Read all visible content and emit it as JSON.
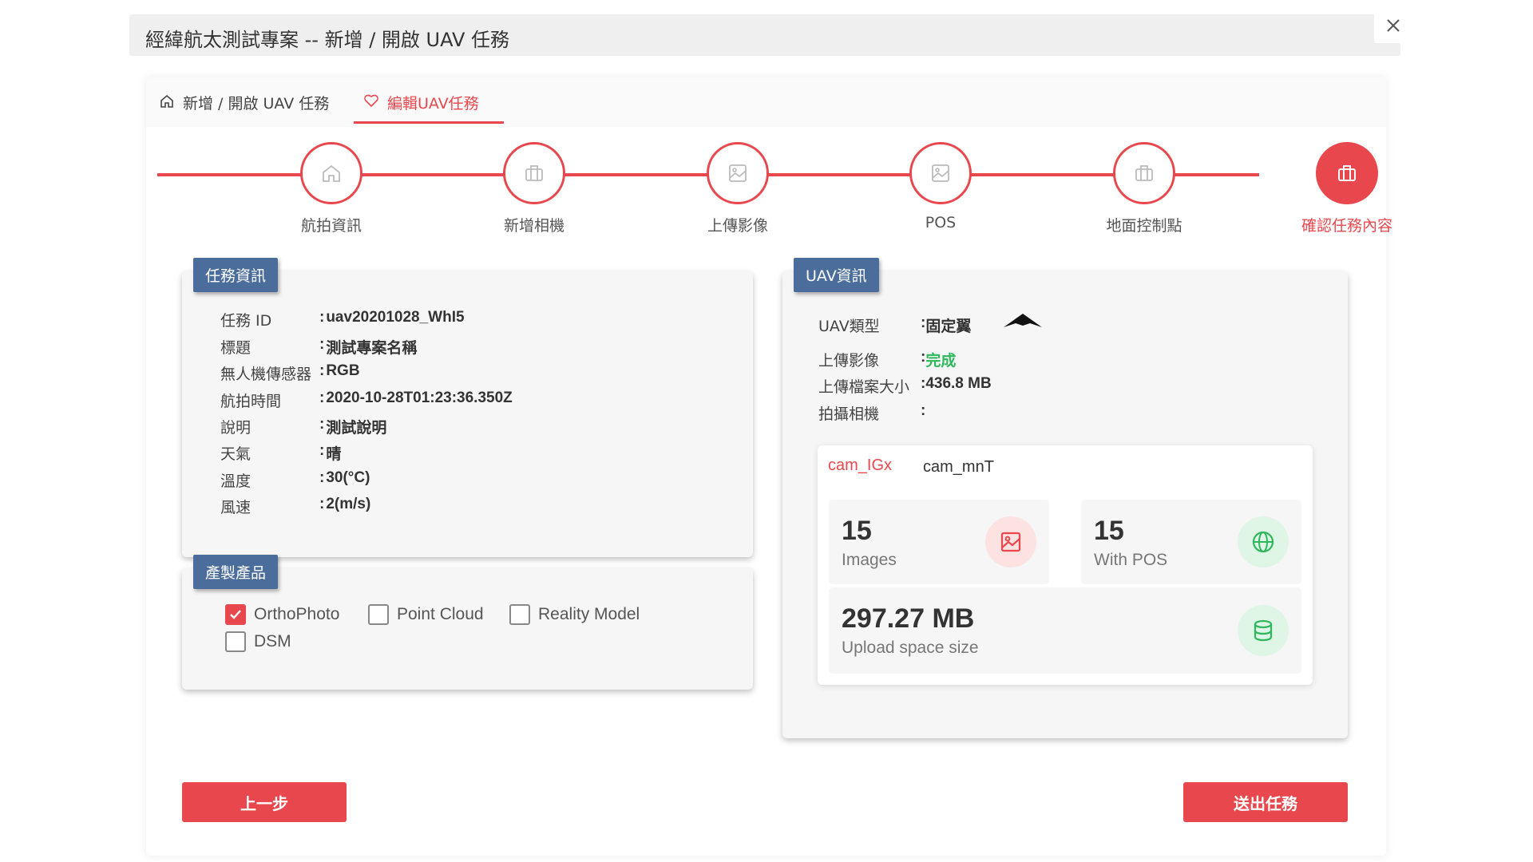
{
  "window": {
    "title": "經緯航太測試專案 -- 新增 / 開啟 UAV 任務"
  },
  "breadcrumb": {
    "home_label": "新增 / 開啟 UAV 任務",
    "edit_label": "編輯UAV任務"
  },
  "steps": [
    {
      "label": "航拍資訊",
      "icon": "home-icon"
    },
    {
      "label": "新增相機",
      "icon": "briefcase-icon"
    },
    {
      "label": "上傳影像",
      "icon": "image-icon"
    },
    {
      "label": "POS",
      "icon": "image-icon"
    },
    {
      "label": "地面控制點",
      "icon": "briefcase-icon"
    },
    {
      "label": "確認任務內容",
      "icon": "briefcase-icon",
      "active": true
    }
  ],
  "task_info": {
    "tag": "任務資訊",
    "rows": [
      {
        "key": "任務 ID",
        "value": "uav20201028_WhI5"
      },
      {
        "key": "標題",
        "value": "測試專案名稱"
      },
      {
        "key": "無人機傳感器",
        "value": "RGB"
      },
      {
        "key": "航拍時間",
        "value": "2020-10-28T01:23:36.350Z"
      },
      {
        "key": "說明",
        "value": "測試說明"
      },
      {
        "key": "天氣",
        "value": "晴"
      },
      {
        "key": "溫度",
        "value": "30(°C)"
      },
      {
        "key": "風速",
        "value": "2(m/s)"
      }
    ]
  },
  "products": {
    "tag": "產製產品",
    "options": [
      {
        "label": "OrthoPhoto",
        "checked": true
      },
      {
        "label": "Point Cloud",
        "checked": false
      },
      {
        "label": "Reality Model",
        "checked": false
      },
      {
        "label": "DSM",
        "checked": false
      }
    ]
  },
  "uav_info": {
    "tag": "UAV資訊",
    "type_key": "UAV類型",
    "type_value": "固定翼",
    "upload_key": "上傳影像",
    "upload_value": "完成",
    "size_key": "上傳檔案大小",
    "size_value": "436.8 MB",
    "camera_key": "拍攝相機",
    "camera_tabs": [
      "cam_IGx",
      "cam_mnT"
    ],
    "stats": {
      "images_count": "15",
      "images_label": "Images",
      "pos_count": "15",
      "pos_label": "With POS",
      "space_value": "297.27 MB",
      "space_label": "Upload space size"
    }
  },
  "colors": {
    "accent": "#e8484d",
    "tag_blue": "#4b6d9b",
    "success": "#2eb85c"
  },
  "buttons": {
    "prev": "上一步",
    "submit": "送出任務"
  }
}
